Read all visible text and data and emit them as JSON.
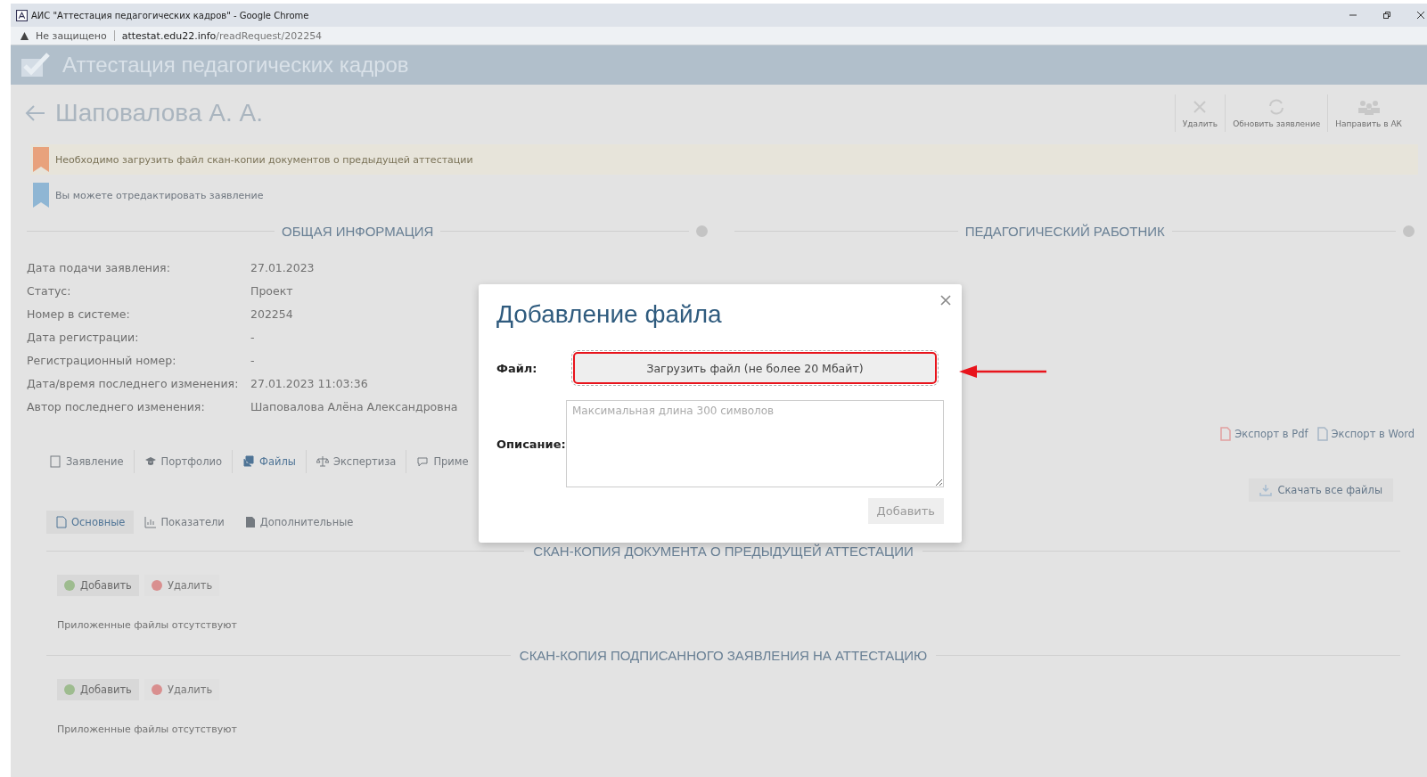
{
  "browser": {
    "title": "АИС \"Аттестация педагогических кадров\" - Google Chrome",
    "security": "Не защищено",
    "url": "**attestat.edu22.info**/readRequest/202254"
  },
  "app": {
    "title": "Аттестация педагогических кадров"
  },
  "page": {
    "title": "Шаповалова А. А.",
    "toolbar": [
      {
        "kind": "delete",
        "label": "Удалить"
      },
      {
        "kind": "refresh",
        "label": "Обновить заявление"
      },
      {
        "kind": "send",
        "label": "Направить в АК"
      }
    ]
  },
  "alerts": [
    {
      "kind": "warning",
      "color": "#e8a27c",
      "text": "Необходимо загрузить файл скан-копии документов о предыдущей аттестации"
    },
    {
      "kind": "info",
      "color": "#8fb6d4",
      "text": "Вы можете отредактировать заявление"
    }
  ],
  "sections": [
    {
      "title": "ОБЩАЯ ИНФОРМАЦИЯ"
    },
    {
      "title": "ПЕДАГОГИЧЕСКИЙ РАБОТНИК"
    }
  ],
  "info": [
    {
      "label": "Дата подачи заявления:",
      "value": "27.01.2023"
    },
    {
      "label": "Статус:",
      "value": "Проект"
    },
    {
      "label": "Номер в системе:",
      "value": "202254"
    },
    {
      "label": "Дата регистрации:",
      "value": "-"
    },
    {
      "label": "Регистрационный номер:",
      "value": "-"
    },
    {
      "label": "Дата/время последнего изменения:",
      "value": "27.01.2023 11:03:36"
    },
    {
      "label": "Автор последнего изменения:",
      "value": "Шаповалова Алёна Александровна"
    }
  ],
  "exports": [
    {
      "kind": "pdf",
      "label": "Экспорт в Pdf"
    },
    {
      "kind": "word",
      "label": "Экспорт в Word"
    }
  ],
  "tabs": [
    {
      "kind": "doc",
      "label": "Заявление",
      "selected": false
    },
    {
      "kind": "cap",
      "label": "Портфолио",
      "selected": false
    },
    {
      "kind": "files",
      "label": "Файлы",
      "selected": true
    },
    {
      "kind": "scales",
      "label": "Экспертиза",
      "selected": false
    },
    {
      "kind": "chat",
      "label": "Приме",
      "selected": false
    }
  ],
  "download_all": "Скачать все файлы",
  "subtabs": [
    {
      "kind": "page",
      "label": "Основные",
      "selected": true
    },
    {
      "kind": "chart",
      "label": "Показатели",
      "selected": false
    },
    {
      "kind": "file",
      "label": "Дополнительные",
      "selected": false
    }
  ],
  "file_sections": [
    {
      "title": "СКАН-КОПИЯ ДОКУМЕНТА О ПРЕДЫДУЩЕЙ АТТЕСТАЦИИ",
      "add": "Добавить",
      "remove": "Удалить",
      "empty": "Приложенные файлы отсутствуют"
    },
    {
      "title": "СКАН-КОПИЯ ПОДПИСАННОГО ЗАЯВЛЕНИЯ НА АТТЕСТАЦИЮ",
      "add": "Добавить",
      "remove": "Удалить",
      "empty": "Приложенные файлы отсутствуют"
    }
  ],
  "modal": {
    "title": "Добавление файла",
    "file_label": "Файл:",
    "upload": "Загрузить файл (не более 20 Мбайт)",
    "description_label": "Описание:",
    "placeholder": "Максимальная длина 300 символов",
    "submit": "Добавить"
  }
}
